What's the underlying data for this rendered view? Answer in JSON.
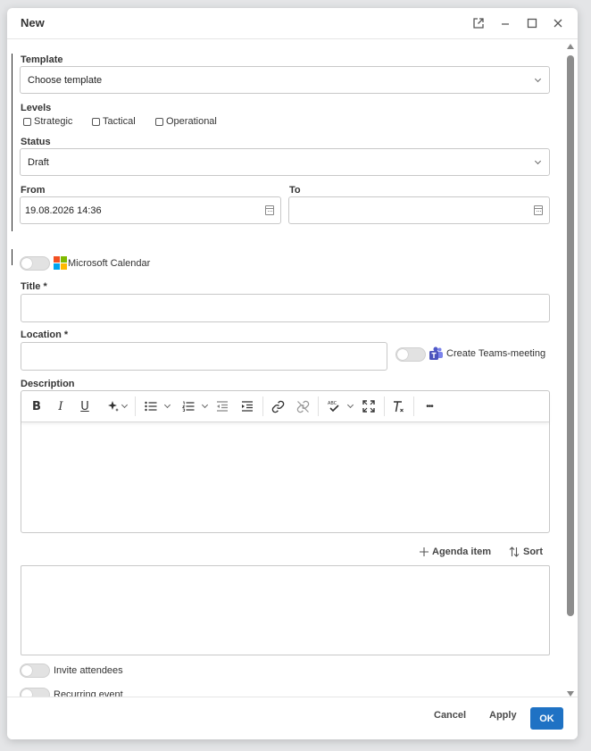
{
  "window": {
    "title": "New",
    "popout_icon": "external-link-icon",
    "minimize_icon": "minimize-icon",
    "maximize_icon": "maximize-icon",
    "close_icon": "close-icon"
  },
  "form": {
    "template": {
      "label": "Template",
      "value": "Choose template"
    },
    "levels": {
      "label": "Levels",
      "options": [
        {
          "label": "Strategic",
          "checked": false
        },
        {
          "label": "Tactical",
          "checked": false
        },
        {
          "label": "Operational",
          "checked": false
        }
      ]
    },
    "status": {
      "label": "Status",
      "value": "Draft"
    },
    "from": {
      "label": "From",
      "value": "19.08.2026 14:36"
    },
    "to": {
      "label": "To",
      "value": ""
    },
    "microsoft_calendar": {
      "label": "Microsoft Calendar",
      "on": false
    },
    "title": {
      "label": "Title *",
      "value": ""
    },
    "location": {
      "label": "Location *",
      "value": ""
    },
    "teams": {
      "label": "Create Teams-meeting",
      "on": false
    },
    "description": {
      "label": "Description",
      "toolbar": {
        "bold": "B",
        "italic": "I",
        "underline": "U",
        "more": "•••"
      }
    },
    "agenda": {
      "add_label": "Agenda item",
      "sort_label": "Sort"
    },
    "invite_attendees": {
      "label": "Invite attendees",
      "on": false
    },
    "recurring_event": {
      "label": "Recurring event",
      "on": false
    }
  },
  "footer": {
    "cancel": "Cancel",
    "apply": "Apply",
    "ok": "OK"
  },
  "colors": {
    "accent": "#1f72c4",
    "ms_red": "#f25022",
    "ms_green": "#7fba00",
    "ms_blue": "#00a4ef",
    "ms_yellow": "#ffb900",
    "teams_purple": "#5059c9"
  }
}
